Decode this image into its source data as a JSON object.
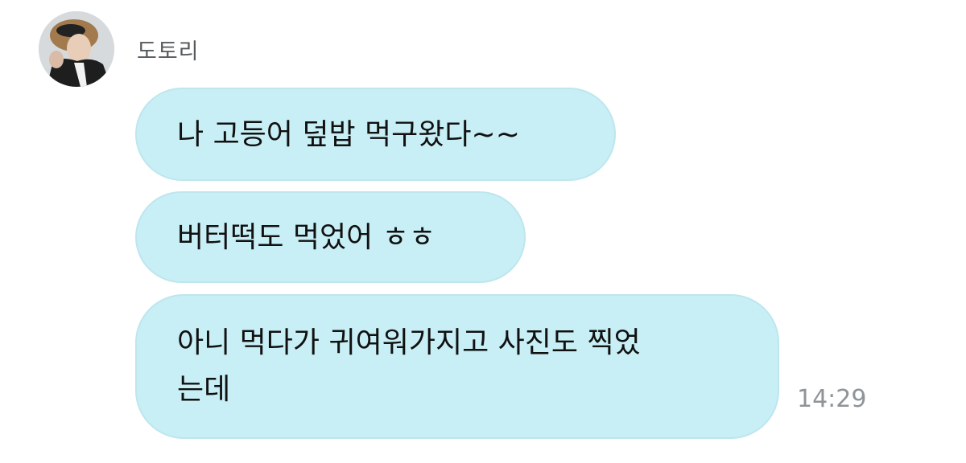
{
  "sender": {
    "name": "도토리",
    "avatar": "avatar-photo"
  },
  "messages": [
    {
      "lines": [
        "나 고등어 덮밥 먹구왔다~~"
      ]
    },
    {
      "lines": [
        "버터떡도 먹었어 ㅎㅎ"
      ]
    },
    {
      "lines": [
        "아니 먹다가 귀여워가지고 사진도 찍었",
        "는데"
      ]
    }
  ],
  "timestamp": "14:29",
  "colors": {
    "bubble": "#c8eff5",
    "bubble_border": "#bde6ee",
    "timestamp": "#8f9499",
    "sender": "#555a5e"
  }
}
